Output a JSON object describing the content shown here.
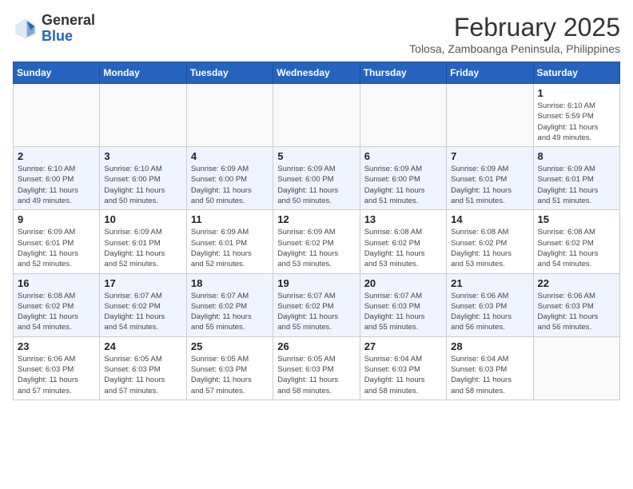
{
  "header": {
    "logo_general": "General",
    "logo_blue": "Blue",
    "month_year": "February 2025",
    "location": "Tolosa, Zamboanga Peninsula, Philippines"
  },
  "weekdays": [
    "Sunday",
    "Monday",
    "Tuesday",
    "Wednesday",
    "Thursday",
    "Friday",
    "Saturday"
  ],
  "weeks": [
    [
      {
        "day": "",
        "info": ""
      },
      {
        "day": "",
        "info": ""
      },
      {
        "day": "",
        "info": ""
      },
      {
        "day": "",
        "info": ""
      },
      {
        "day": "",
        "info": ""
      },
      {
        "day": "",
        "info": ""
      },
      {
        "day": "1",
        "info": "Sunrise: 6:10 AM\nSunset: 5:59 PM\nDaylight: 11 hours\nand 49 minutes."
      }
    ],
    [
      {
        "day": "2",
        "info": "Sunrise: 6:10 AM\nSunset: 6:00 PM\nDaylight: 11 hours\nand 49 minutes."
      },
      {
        "day": "3",
        "info": "Sunrise: 6:10 AM\nSunset: 6:00 PM\nDaylight: 11 hours\nand 50 minutes."
      },
      {
        "day": "4",
        "info": "Sunrise: 6:09 AM\nSunset: 6:00 PM\nDaylight: 11 hours\nand 50 minutes."
      },
      {
        "day": "5",
        "info": "Sunrise: 6:09 AM\nSunset: 6:00 PM\nDaylight: 11 hours\nand 50 minutes."
      },
      {
        "day": "6",
        "info": "Sunrise: 6:09 AM\nSunset: 6:00 PM\nDaylight: 11 hours\nand 51 minutes."
      },
      {
        "day": "7",
        "info": "Sunrise: 6:09 AM\nSunset: 6:01 PM\nDaylight: 11 hours\nand 51 minutes."
      },
      {
        "day": "8",
        "info": "Sunrise: 6:09 AM\nSunset: 6:01 PM\nDaylight: 11 hours\nand 51 minutes."
      }
    ],
    [
      {
        "day": "9",
        "info": "Sunrise: 6:09 AM\nSunset: 6:01 PM\nDaylight: 11 hours\nand 52 minutes."
      },
      {
        "day": "10",
        "info": "Sunrise: 6:09 AM\nSunset: 6:01 PM\nDaylight: 11 hours\nand 52 minutes."
      },
      {
        "day": "11",
        "info": "Sunrise: 6:09 AM\nSunset: 6:01 PM\nDaylight: 11 hours\nand 52 minutes."
      },
      {
        "day": "12",
        "info": "Sunrise: 6:09 AM\nSunset: 6:02 PM\nDaylight: 11 hours\nand 53 minutes."
      },
      {
        "day": "13",
        "info": "Sunrise: 6:08 AM\nSunset: 6:02 PM\nDaylight: 11 hours\nand 53 minutes."
      },
      {
        "day": "14",
        "info": "Sunrise: 6:08 AM\nSunset: 6:02 PM\nDaylight: 11 hours\nand 53 minutes."
      },
      {
        "day": "15",
        "info": "Sunrise: 6:08 AM\nSunset: 6:02 PM\nDaylight: 11 hours\nand 54 minutes."
      }
    ],
    [
      {
        "day": "16",
        "info": "Sunrise: 6:08 AM\nSunset: 6:02 PM\nDaylight: 11 hours\nand 54 minutes."
      },
      {
        "day": "17",
        "info": "Sunrise: 6:07 AM\nSunset: 6:02 PM\nDaylight: 11 hours\nand 54 minutes."
      },
      {
        "day": "18",
        "info": "Sunrise: 6:07 AM\nSunset: 6:02 PM\nDaylight: 11 hours\nand 55 minutes."
      },
      {
        "day": "19",
        "info": "Sunrise: 6:07 AM\nSunset: 6:02 PM\nDaylight: 11 hours\nand 55 minutes."
      },
      {
        "day": "20",
        "info": "Sunrise: 6:07 AM\nSunset: 6:03 PM\nDaylight: 11 hours\nand 55 minutes."
      },
      {
        "day": "21",
        "info": "Sunrise: 6:06 AM\nSunset: 6:03 PM\nDaylight: 11 hours\nand 56 minutes."
      },
      {
        "day": "22",
        "info": "Sunrise: 6:06 AM\nSunset: 6:03 PM\nDaylight: 11 hours\nand 56 minutes."
      }
    ],
    [
      {
        "day": "23",
        "info": "Sunrise: 6:06 AM\nSunset: 6:03 PM\nDaylight: 11 hours\nand 57 minutes."
      },
      {
        "day": "24",
        "info": "Sunrise: 6:05 AM\nSunset: 6:03 PM\nDaylight: 11 hours\nand 57 minutes."
      },
      {
        "day": "25",
        "info": "Sunrise: 6:05 AM\nSunset: 6:03 PM\nDaylight: 11 hours\nand 57 minutes."
      },
      {
        "day": "26",
        "info": "Sunrise: 6:05 AM\nSunset: 6:03 PM\nDaylight: 11 hours\nand 58 minutes."
      },
      {
        "day": "27",
        "info": "Sunrise: 6:04 AM\nSunset: 6:03 PM\nDaylight: 11 hours\nand 58 minutes."
      },
      {
        "day": "28",
        "info": "Sunrise: 6:04 AM\nSunset: 6:03 PM\nDaylight: 11 hours\nand 58 minutes."
      },
      {
        "day": "",
        "info": ""
      }
    ]
  ]
}
